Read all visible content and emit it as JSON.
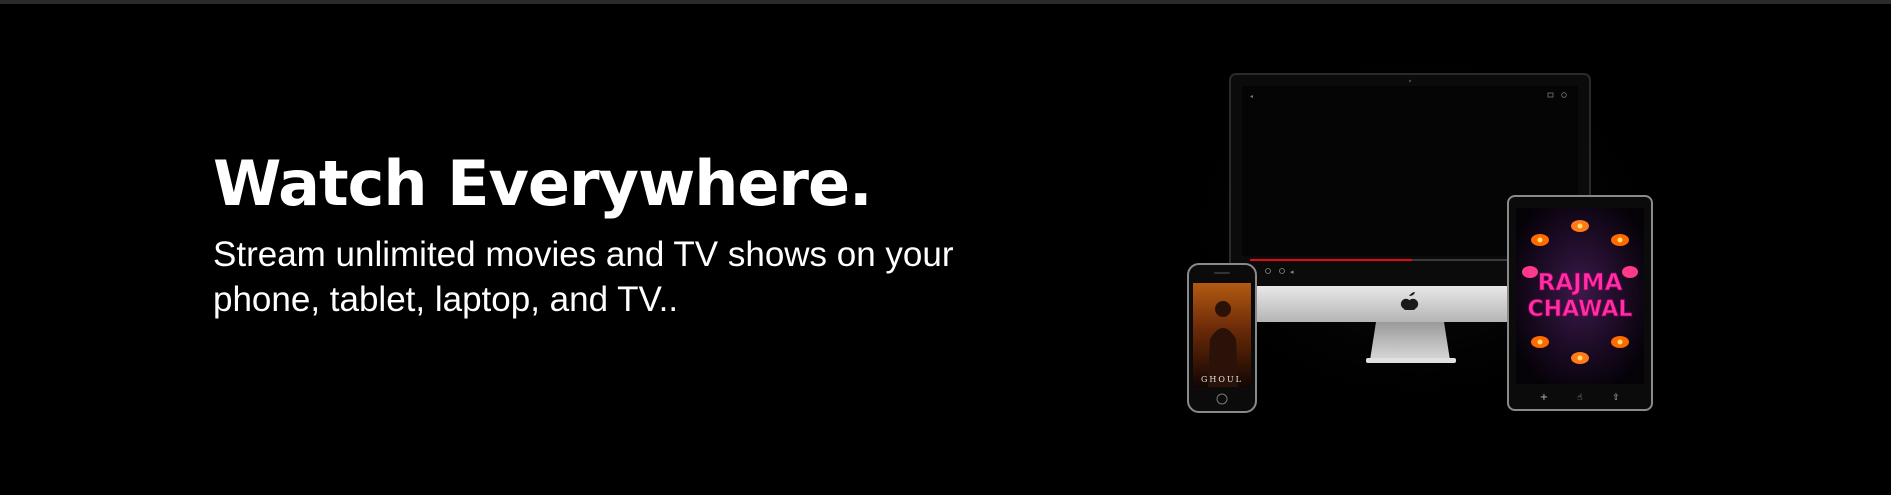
{
  "hero": {
    "headline": "Watch Everywhere.",
    "subheadline": "Stream unlimited movies and TV shows on your phone, tablet, laptop, and TV.."
  },
  "devices": {
    "phone_poster_title": "GHOUL",
    "tablet_poster_title_line1": "RAJMA",
    "tablet_poster_title_line2": "CHAWAL"
  },
  "colors": {
    "background": "#000000",
    "text": "#ffffff",
    "progress_red": "#e50914",
    "poster_pink": "#ff2fa8"
  }
}
